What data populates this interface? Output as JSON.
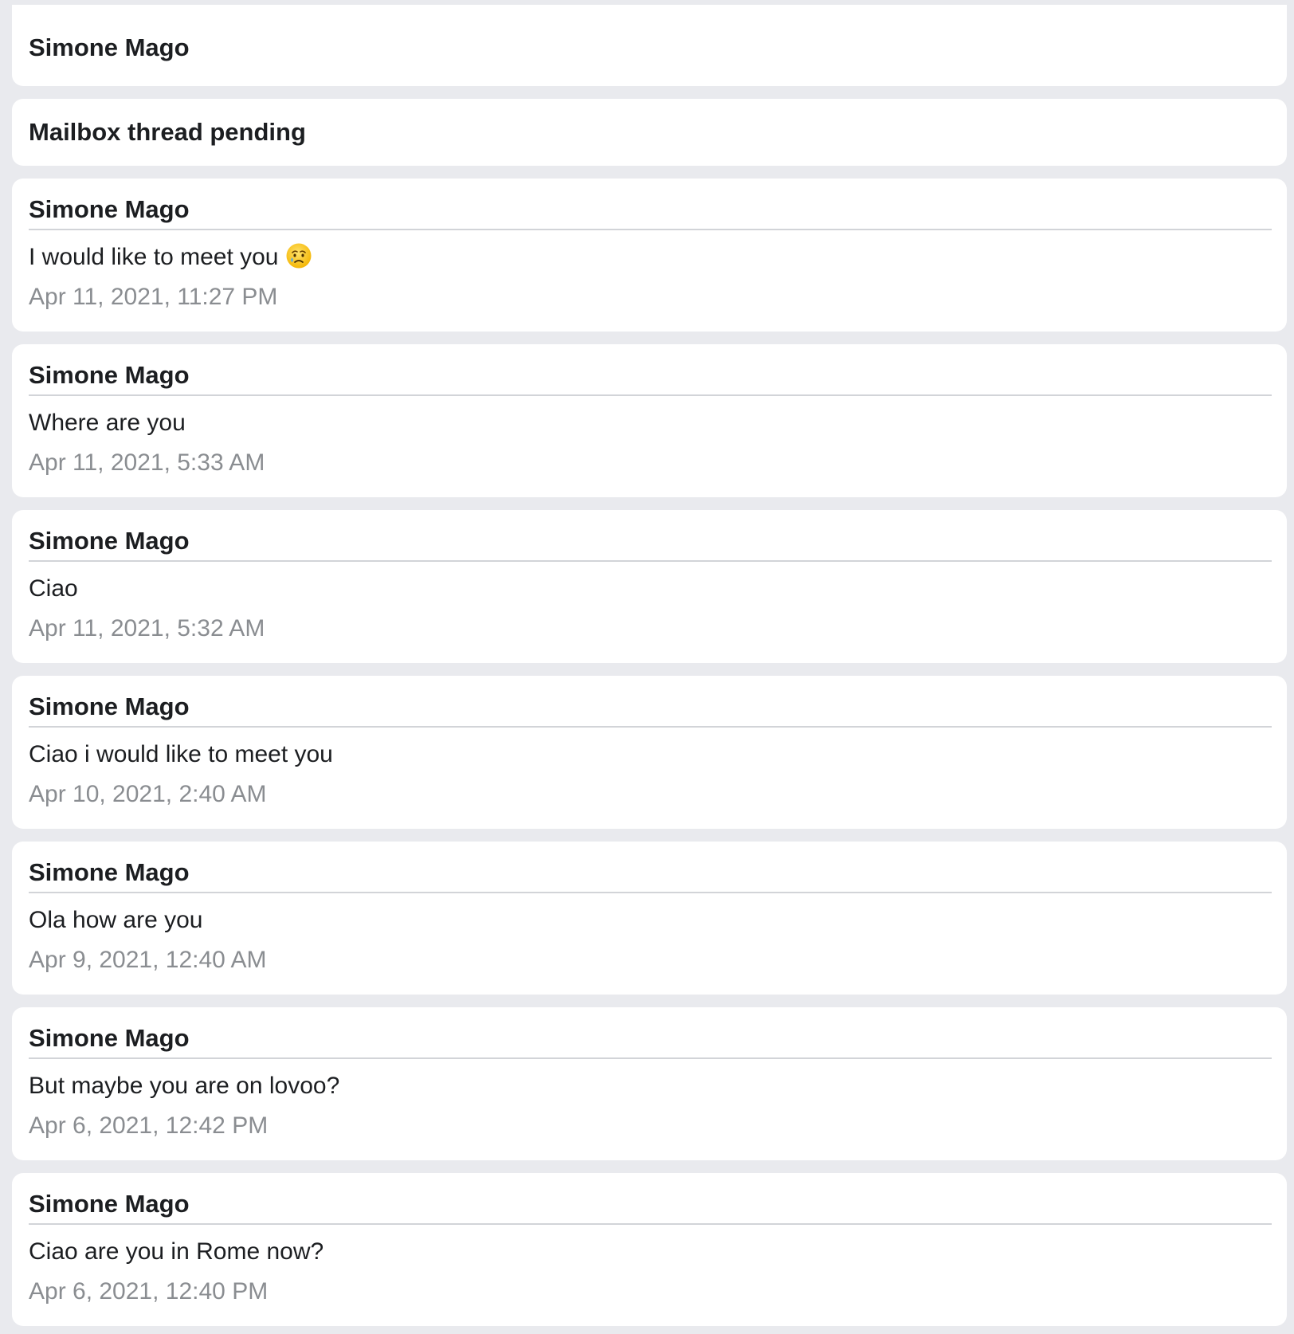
{
  "header": {
    "title": "Simone Mago"
  },
  "status": {
    "title": "Mailbox thread pending"
  },
  "messages": [
    {
      "sender": "Simone Mago",
      "text": "I would like to meet you",
      "emoji": "crying-face-icon",
      "time": "Apr 11, 2021, 11:27 PM"
    },
    {
      "sender": "Simone Mago",
      "text": "Where are you",
      "time": "Apr 11, 2021, 5:33 AM"
    },
    {
      "sender": "Simone Mago",
      "text": "Ciao",
      "time": "Apr 11, 2021, 5:32 AM"
    },
    {
      "sender": "Simone Mago",
      "text": "Ciao i would like to meet you",
      "time": "Apr 10, 2021, 2:40 AM"
    },
    {
      "sender": "Simone Mago",
      "text": "Ola how are you",
      "time": "Apr 9, 2021, 12:40 AM"
    },
    {
      "sender": "Simone Mago",
      "text": "But maybe you are on lovoo?",
      "time": "Apr 6, 2021, 12:42 PM"
    },
    {
      "sender": "Simone Mago",
      "text": "Ciao are you in Rome now?",
      "time": "Apr 6, 2021, 12:40 PM"
    }
  ],
  "colors": {
    "background": "#e9eaee",
    "card": "#ffffff",
    "text": "#1c1e21",
    "timestamp": "#8a8d91",
    "divider": "#d2d4d8"
  }
}
